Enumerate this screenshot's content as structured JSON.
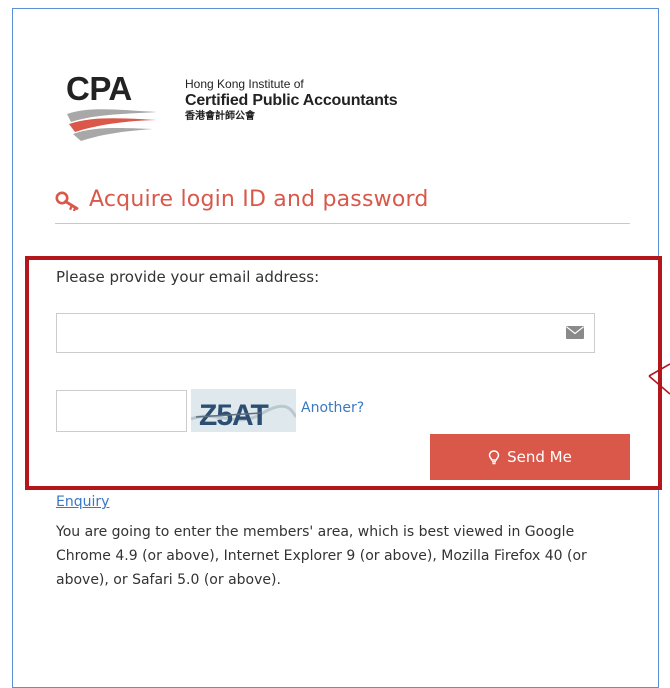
{
  "logo": {
    "abbreviation": "CPA",
    "line1": "Hong Kong Institute of",
    "line2": "Certified Public Accountants",
    "line3": "香港會計師公會"
  },
  "heading": {
    "icon": "key-icon",
    "title": "Acquire login ID and password"
  },
  "form": {
    "email_label": "Please provide your email address:",
    "email_value": "",
    "email_icon": "envelope-icon",
    "captcha_value": "",
    "captcha_text": "Z5AT",
    "captcha_refresh_label": "Another?",
    "send_icon": "lightbulb-icon",
    "send_label": "Send Me"
  },
  "enquiry_label": "Enquiry",
  "info_text": "You are going to enter the members' area, which is best viewed in Google Chrome 4.9 (or above), Internet Explorer 9 (or above), Mozilla Firefox 40 (or above), or Safari 5.0 (or above).",
  "colors": {
    "accent": "#d9584a",
    "link": "#3a78c2",
    "highlight_border": "#b3161b",
    "frame_border": "#5b8fd6"
  }
}
